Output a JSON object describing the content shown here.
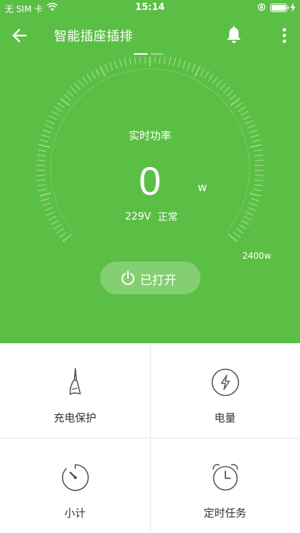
{
  "status_bar": {
    "carrier": "无 SIM 卡",
    "time": "15:14"
  },
  "header": {
    "title": "智能插座插排"
  },
  "gauge": {
    "label": "实时功率",
    "value": "0",
    "unit": "w",
    "voltage": "229V",
    "state": "正常",
    "max_label": "2400w",
    "current_fraction": 0
  },
  "toggle": {
    "label": "已打开"
  },
  "functions": [
    {
      "label": "充电保护",
      "icon": "brush-icon"
    },
    {
      "label": "电量",
      "icon": "lightning-icon"
    },
    {
      "label": "小计",
      "icon": "stopwatch-icon"
    },
    {
      "label": "定时任务",
      "icon": "alarm-clock-icon"
    }
  ],
  "colors": {
    "primary_green": "#5cbf45",
    "icon_gray": "#555555",
    "divider": "#e6e6e6"
  }
}
